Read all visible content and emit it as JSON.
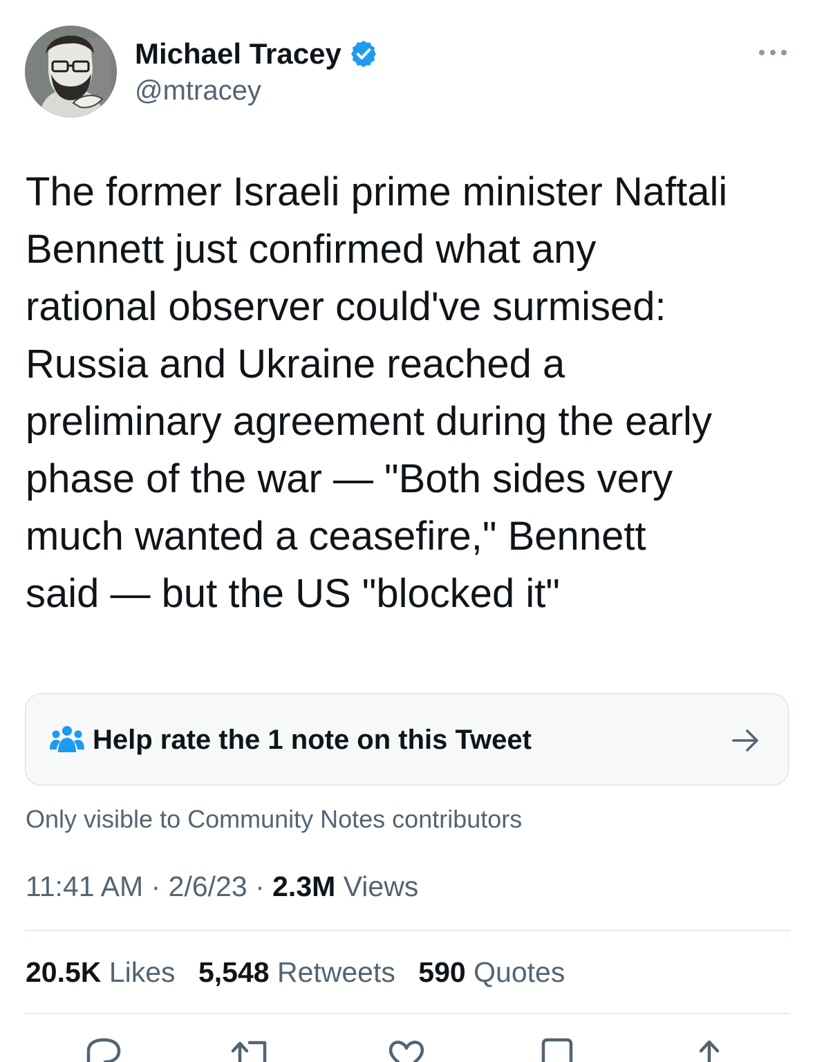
{
  "author": {
    "name": "Michael Tracey",
    "handle": "@mtracey",
    "verified_color": "#1d9bf0"
  },
  "tweet": {
    "lines": [
      "The former Israeli prime minister Naftali",
      "Bennett just confirmed what any",
      "rational observer could've surmised:",
      "Russia and Ukraine reached a",
      "preliminary agreement during the early",
      "phase of the war — \"Both sides very",
      "much wanted a ceasefire,\" Bennett",
      "said — but the US \"blocked it\""
    ]
  },
  "community_note": {
    "label": "Help rate the 1 note on this Tweet",
    "visibility_text": "Only visible to Community Notes contributors",
    "icon": "people-icon",
    "accent_color": "#1d9bf0"
  },
  "meta": {
    "time": "11:41 AM",
    "separator": "·",
    "date": "2/6/23",
    "views_count": "2.3M",
    "views_label": "Views"
  },
  "stats": {
    "likes_count": "20.5K",
    "likes_label": "Likes",
    "retweets_count": "5,548",
    "retweets_label": "Retweets",
    "quotes_count": "590",
    "quotes_label": "Quotes"
  },
  "actions": [
    "reply-icon",
    "retweet-icon",
    "like-icon",
    "bookmark-icon",
    "share-icon"
  ]
}
